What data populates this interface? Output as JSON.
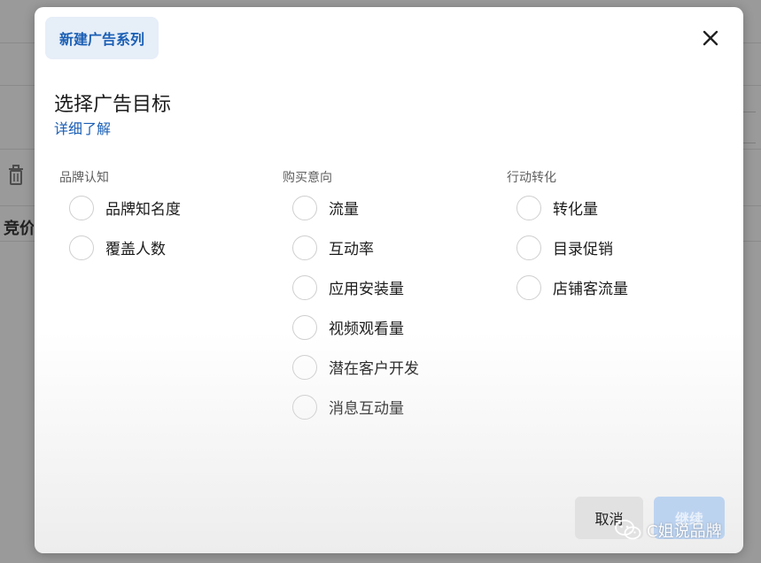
{
  "background": {
    "label_fragment": "竞价"
  },
  "modal": {
    "tab_label": "新建广告系列",
    "heading": "选择广告目标",
    "learn_more": "详细了解",
    "columns": [
      {
        "title": "品牌认知",
        "options": [
          "品牌知名度",
          "覆盖人数"
        ]
      },
      {
        "title": "购买意向",
        "options": [
          "流量",
          "互动率",
          "应用安装量",
          "视频观看量",
          "潜在客户开发",
          "消息互动量"
        ]
      },
      {
        "title": "行动转化",
        "options": [
          "转化量",
          "目录促销",
          "店铺客流量"
        ]
      }
    ],
    "cancel_label": "取消",
    "continue_label": "继续"
  },
  "watermark": {
    "text": "C姐说品牌"
  },
  "icons": {
    "close": "close-icon",
    "trash": "trash-icon",
    "watermark": "wechat-icon"
  },
  "colors": {
    "accent": "#1b5fb5",
    "tab_bg": "#e6eef8",
    "continue_disabled_bg": "#bcd3f0"
  }
}
